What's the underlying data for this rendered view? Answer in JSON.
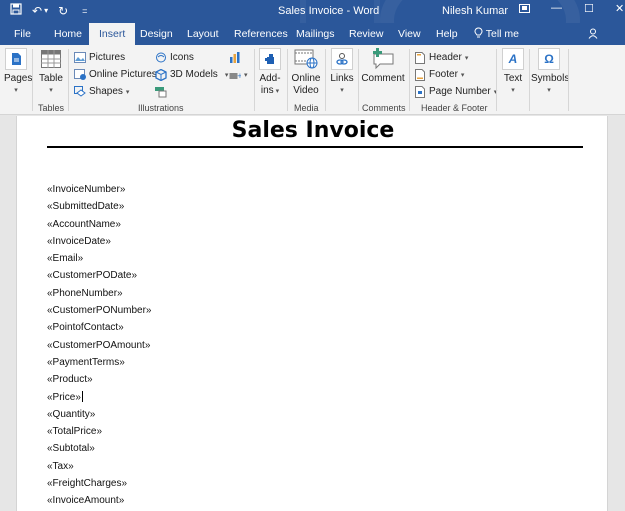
{
  "window": {
    "title": "Sales Invoice  -  Word",
    "user": "Nilesh Kumar",
    "controls": {
      "restore_ribbon": "restore-ribbon-icon",
      "minimize": "—",
      "maximize": "☐",
      "close": "✕"
    }
  },
  "quick_access": {
    "save": "💾",
    "undo": "↶",
    "undo_dropdown": "▾",
    "redo": "↻",
    "customize": "⩧"
  },
  "tabs": [
    {
      "label": "File",
      "active": false
    },
    {
      "label": "Home",
      "active": false
    },
    {
      "label": "Insert",
      "active": true
    },
    {
      "label": "Design",
      "active": false
    },
    {
      "label": "Layout",
      "active": false
    },
    {
      "label": "References",
      "active": false
    },
    {
      "label": "Mailings",
      "active": false
    },
    {
      "label": "Review",
      "active": false
    },
    {
      "label": "View",
      "active": false
    },
    {
      "label": "Help",
      "active": false
    }
  ],
  "tell_me": {
    "icon": "◯",
    "label": "Tell me"
  },
  "share": {
    "icon": "☺",
    "label": "Share"
  },
  "ribbon": {
    "groups": {
      "pages": {
        "button": "Pages",
        "label": ""
      },
      "tables": {
        "button": "Table",
        "label": "Tables"
      },
      "illustrations": {
        "label": "Illustrations",
        "items": [
          "Pictures",
          "Online Pictures",
          "Shapes",
          "Icons",
          "3D Models"
        ]
      },
      "addins": {
        "button_line1": "Add-",
        "button_line2": "ins"
      },
      "media": {
        "button_line1": "Online",
        "button_line2": "Video",
        "label": "Media"
      },
      "links": {
        "button": "Links"
      },
      "comments": {
        "button": "Comment",
        "label": "Comments"
      },
      "header_footer": {
        "label": "Header & Footer",
        "items": [
          "Header",
          "Footer",
          "Page Number"
        ]
      },
      "text": {
        "button": "Text"
      },
      "symbols": {
        "button": "Symbols"
      }
    }
  },
  "document": {
    "title": "Sales Invoice",
    "fields": [
      "«InvoiceNumber»",
      "«SubmittedDate»",
      "«AccountName»",
      "«InvoiceDate»",
      "«Email»",
      "«CustomerPODate»",
      "«PhoneNumber»",
      "«CustomerPONumber»",
      "«PointofContact»",
      "«CustomerPOAmount»",
      "«PaymentTerms»",
      "«Product»",
      "«Price»",
      "«Quantity»",
      "«TotalPrice»",
      "«Subtotal»",
      "«Tax»",
      "«FreightCharges»",
      "«InvoiceAmount»"
    ],
    "cursor_after_field_index": 12
  },
  "colors": {
    "word_blue": "#2b579a",
    "ribbon_bg": "#f3f3f3",
    "canvas_bg": "#e6e6e6"
  }
}
